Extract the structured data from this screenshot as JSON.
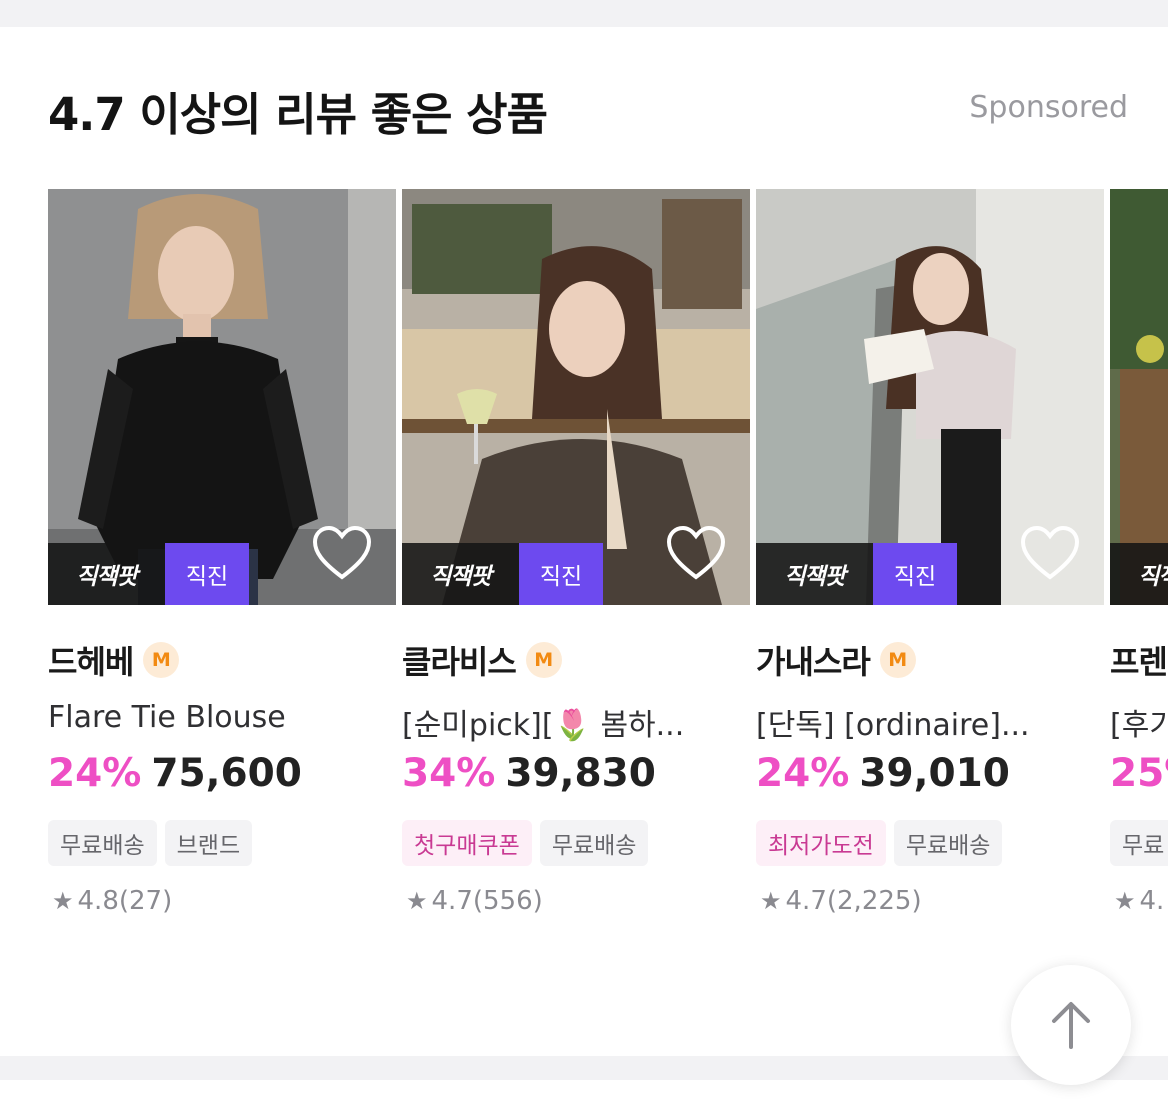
{
  "section": {
    "title": "4.7 이상의 리뷰 좋은 상품",
    "sponsored": "Sponsored"
  },
  "badges": {
    "logo_text": "직잭팟",
    "tag_text": "직진",
    "tag_color": "#6d4aef"
  },
  "colors": {
    "discount": "#ee4fc4",
    "membership": "#f28a12",
    "pink_chip_text": "#c93a93"
  },
  "icons": {
    "wishlist": "heart-outline-icon",
    "membership": "m-badge-icon",
    "rating": "star-icon",
    "scroll": "arrow-up-icon"
  },
  "products": [
    {
      "brand": "드헤베",
      "membership": "M",
      "name": "Flare Tie Blouse",
      "discount": "24%",
      "price": "75,600",
      "chips": [
        {
          "label": "무료배송",
          "style": "gray"
        },
        {
          "label": "브랜드",
          "style": "gray"
        }
      ],
      "rating": "4.8",
      "reviews": "(27)"
    },
    {
      "brand": "클라비스",
      "membership": "M",
      "name": "[순미pick][🌷 봄하...",
      "discount": "34%",
      "price": "39,830",
      "chips": [
        {
          "label": "첫구매쿠폰",
          "style": "pink"
        },
        {
          "label": "무료배송",
          "style": "gray"
        }
      ],
      "rating": "4.7",
      "reviews": "(556)"
    },
    {
      "brand": "가내스라",
      "membership": "M",
      "name": "[단독] [ordinaire]...",
      "discount": "24%",
      "price": "39,010",
      "chips": [
        {
          "label": "최저가도전",
          "style": "pink"
        },
        {
          "label": "무료배송",
          "style": "gray"
        }
      ],
      "rating": "4.7",
      "reviews": "(2,225)"
    },
    {
      "brand": "프렌",
      "name": "[후기",
      "discount": "25%",
      "price": "",
      "chips": [
        {
          "label": "무료",
          "style": "gray"
        }
      ],
      "rating": "4.",
      "reviews": ""
    }
  ]
}
